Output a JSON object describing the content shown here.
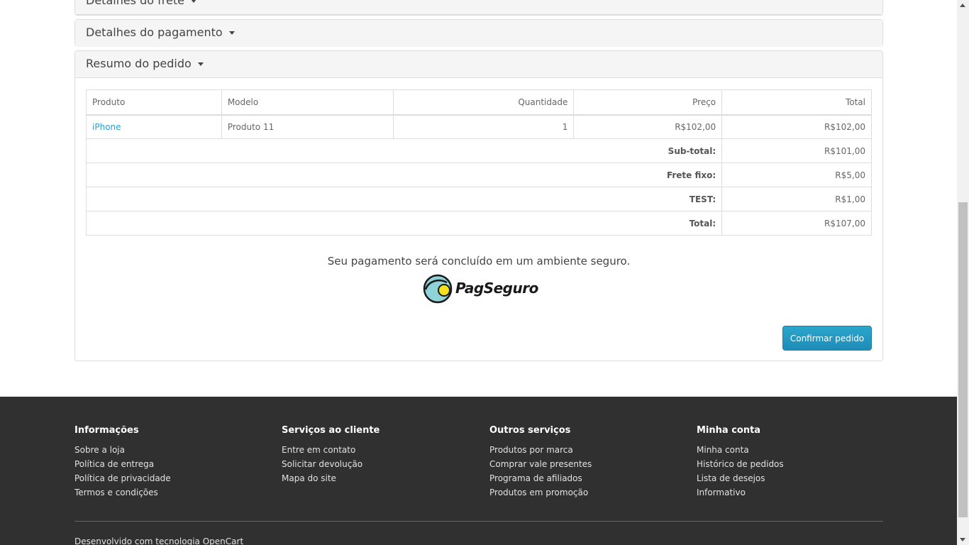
{
  "panels": {
    "shipping_title": "Detalhes do frete",
    "payment_title": "Detalhes do pagamento",
    "summary_title": "Resumo do pedido"
  },
  "order_table": {
    "headers": [
      "Produto",
      "Modelo",
      "Quantidade",
      "Preço",
      "Total"
    ],
    "rows": [
      {
        "product": "iPhone",
        "model": "Produto 11",
        "quantity": "1",
        "price": "R$102,00",
        "total": "R$102,00"
      }
    ],
    "totals": [
      {
        "label": "Sub-total:",
        "value": "R$101,00"
      },
      {
        "label": "Frete fixo:",
        "value": "R$5,00"
      },
      {
        "label": "TEST:",
        "value": "R$1,00"
      },
      {
        "label": "Total:",
        "value": "R$107,00"
      }
    ]
  },
  "payment": {
    "secure_message": "Seu pagamento será concluído em um ambiente seguro.",
    "logo_text": "PagSeguro",
    "confirm_label": "Confirmar pedido"
  },
  "footer": {
    "columns": [
      {
        "title": "Informações",
        "links": [
          "Sobre a loja",
          "Política de entrega",
          "Política de privacidade",
          "Termos e condições"
        ]
      },
      {
        "title": "Serviços ao cliente",
        "links": [
          "Entre em contato",
          "Solicitar devolução",
          "Mapa do site"
        ]
      },
      {
        "title": "Outros serviços",
        "links": [
          "Produtos por marca",
          "Comprar vale presentes",
          "Programa de afiliados",
          "Produtos em promoção"
        ]
      },
      {
        "title": "Minha conta",
        "links": [
          "Minha conta",
          "Histórico de pedidos",
          "Lista de desejos",
          "Informativo"
        ]
      }
    ],
    "powered_prefix": "Desenvolvido com tecnologia",
    "powered_link": "OpenCart"
  },
  "colors": {
    "link": "#23a1d1",
    "button": "#1e8cb8",
    "footer_bg": "#303030",
    "logo_circle": "#8fd3d8",
    "logo_dot": "#f5e11c"
  },
  "icons": {
    "caret": "caret-down-icon",
    "logo": "pagseguro-logo-icon"
  }
}
